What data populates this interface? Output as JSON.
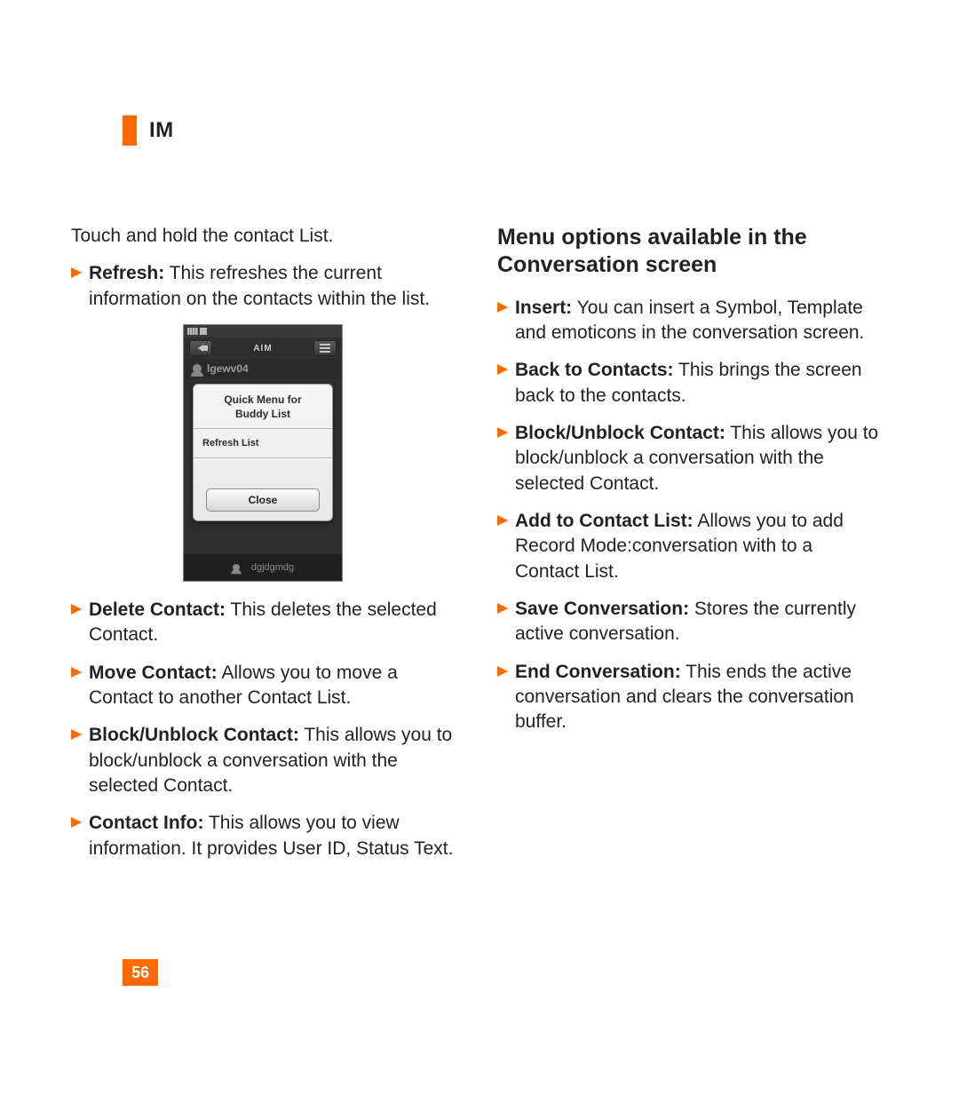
{
  "header": {
    "title": "IM"
  },
  "page_number": "56",
  "left": {
    "intro": "Touch and hold the contact List.",
    "items": [
      {
        "label": "Refresh:",
        "text": " This refreshes the current information on the contacts within the list."
      },
      {
        "label": "Delete Contact:",
        "text": " This deletes the selected Contact."
      },
      {
        "label": "Move Contact:",
        "text": " Allows you to move a Contact to another Contact List."
      },
      {
        "label": "Block/Unblock Contact:",
        "text": " This allows you to block/unblock a conversation with the selected Contact."
      },
      {
        "label": "Contact Info:",
        "text": " This allows you to view information. It provides User ID, Status Text."
      }
    ]
  },
  "right": {
    "heading": "Menu options available in the Conversation screen",
    "items": [
      {
        "label": "Insert:",
        "text": " You can insert a Symbol, Template and emoticons in the conversation screen."
      },
      {
        "label": "Back to Contacts:",
        "text": " This brings the screen back to the contacts."
      },
      {
        "label": "Block/Unblock Contact:",
        "text": " This allows you to block/unblock a conversation with the selected Contact."
      },
      {
        "label": "Add to Contact List:",
        "text": " Allows you to add Record Mode:conversation with to a Contact List."
      },
      {
        "label": "Save Conversation:",
        "text": " Stores the currently active conversation."
      },
      {
        "label": "End Conversation:",
        "text": " This ends the active conversation and clears the conversation buffer."
      }
    ]
  },
  "figure": {
    "titlebar_center": "AIM",
    "name": "lgewv04",
    "popup_title_line1": "Quick Menu for",
    "popup_title_line2": "Buddy List",
    "popup_item": "Refresh List",
    "popup_close": "Close",
    "bottom_name": "dgjdgmdg"
  }
}
